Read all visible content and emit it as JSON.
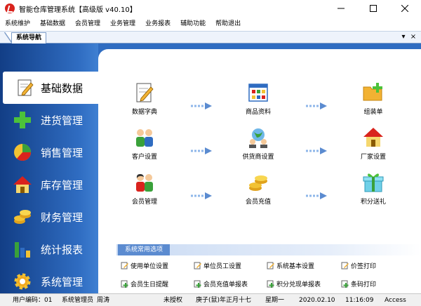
{
  "window": {
    "title": "智能仓库管理系统【高级版 v40.10】",
    "controls": [
      "minimize",
      "maximize",
      "close"
    ]
  },
  "menu": [
    "系统维护",
    "基础数据",
    "会员管理",
    "业务管理",
    "业务报表",
    "辅助功能",
    "帮助退出"
  ],
  "tab": {
    "label": "系统导航",
    "controls": [
      "▾",
      "×"
    ]
  },
  "nav": {
    "items": [
      {
        "label": "基础数据",
        "icon": "pencil-note-icon",
        "active": true
      },
      {
        "label": "进货管理",
        "icon": "green-plus-icon",
        "active": false
      },
      {
        "label": "销售管理",
        "icon": "pie-chart-icon",
        "active": false
      },
      {
        "label": "库存管理",
        "icon": "house-icon",
        "active": false
      },
      {
        "label": "财务管理",
        "icon": "coins-icon",
        "active": false
      },
      {
        "label": "统计报表",
        "icon": "bar-chart-icon",
        "active": false
      },
      {
        "label": "系统管理",
        "icon": "gear-icon",
        "active": false
      }
    ]
  },
  "functions": [
    {
      "label": "数据字典",
      "icon": "pencil-note-icon"
    },
    {
      "label": "商品资料",
      "icon": "product-grid-icon"
    },
    {
      "label": "组装单",
      "icon": "folder-plus-icon"
    },
    {
      "label": "客户设置",
      "icon": "customers-icon"
    },
    {
      "label": "供货商设置",
      "icon": "supplier-globe-icon"
    },
    {
      "label": "厂家设置",
      "icon": "factory-house-icon"
    },
    {
      "label": "会员管理",
      "icon": "members-icon"
    },
    {
      "label": "会员充值",
      "icon": "coins-icon"
    },
    {
      "label": "积分送礼",
      "icon": "gift-icon"
    }
  ],
  "common": {
    "title": "系统常用选项",
    "options": [
      {
        "label": "使用单位设置",
        "icon": "note-edit-icon"
      },
      {
        "label": "单位员工设置",
        "icon": "note-edit-icon"
      },
      {
        "label": "系统基本设置",
        "icon": "note-edit-icon"
      },
      {
        "label": "价签打印",
        "icon": "note-edit-icon"
      },
      {
        "label": "会员生日提醒",
        "icon": "green-add-icon"
      },
      {
        "label": "会员充值单报表",
        "icon": "green-add-icon"
      },
      {
        "label": "积分兑现单报表",
        "icon": "green-add-icon"
      },
      {
        "label": "条码打印",
        "icon": "green-add-icon"
      }
    ]
  },
  "status": {
    "user_code": "用户编码：01",
    "role": "系统管理员",
    "user": "周涛",
    "license": "未授权",
    "lunar_date": "庚子(鼠)年正月十七",
    "weekday": "星期一",
    "date": "2020.02.10",
    "time": "11:16:09",
    "db": "Access"
  },
  "colors": {
    "nav_dark": "#123e86",
    "nav_light": "#3f80d2",
    "accent_red": "#d9231d"
  }
}
